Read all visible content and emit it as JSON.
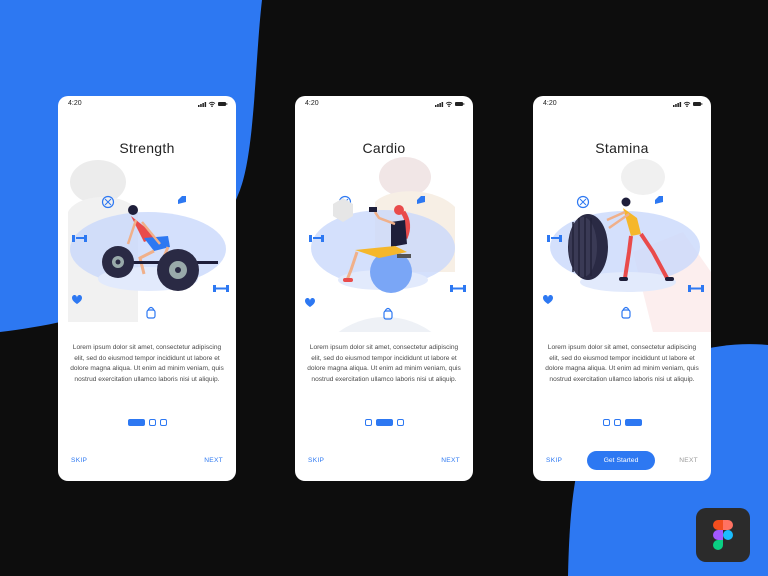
{
  "colors": {
    "accent": "#2d78f2",
    "background": "#0d0d0d",
    "card": "#ffffff"
  },
  "screens": [
    {
      "time": "4:20",
      "title": "Strength",
      "description": "Lorem ipsum dolor sit amet, consectetur adipiscing elit, sed do eiusmod tempor incididunt ut labore et dolore magna aliqua. Ut enim ad minim veniam, quis nostrud exercitation ullamco laboris nisi ut aliquip.",
      "skip_label": "SKIP",
      "next_label": "NEXT",
      "active_page": 1
    },
    {
      "time": "4:20",
      "title": "Cardio",
      "description": "Lorem ipsum dolor sit amet, consectetur adipiscing elit, sed do eiusmod tempor incididunt ut labore et dolore magna aliqua. Ut enim ad minim veniam, quis nostrud exercitation ullamco laboris nisi ut aliquip.",
      "skip_label": "SKIP",
      "next_label": "NEXT",
      "active_page": 2
    },
    {
      "time": "4:20",
      "title": "Stamina",
      "description": "Lorem ipsum dolor sit amet, consectetur adipiscing elit, sed do eiusmod tempor incididunt ut labore et dolore magna aliqua. Ut enim ad minim veniam, quis nostrud exercitation ullamco laboris nisi ut aliquip.",
      "skip_label": "SKIP",
      "primary_button_label": "Get Started",
      "next_label": "NEXT",
      "active_page": 3
    }
  ],
  "icons": [
    "signal-icon",
    "wifi-icon",
    "battery-icon",
    "heart-icon",
    "dumbbell-icon",
    "kettlebell-icon",
    "bicep-icon",
    "weight-plate-icon",
    "figma-logo-icon"
  ]
}
